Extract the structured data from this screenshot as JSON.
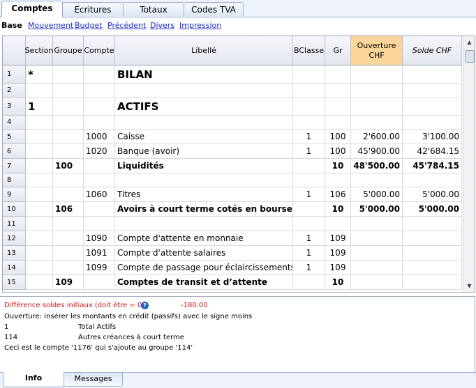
{
  "tabs": [
    {
      "label": "Comptes",
      "active": true
    },
    {
      "label": "Ecritures",
      "active": false
    },
    {
      "label": "Totaux",
      "active": false
    },
    {
      "label": "Codes TVA",
      "active": false
    }
  ],
  "subnav": {
    "current": "Base",
    "links": [
      "Mouvement",
      "Budget",
      "Précédent",
      "Divers",
      "Impression"
    ]
  },
  "columns": [
    {
      "label": "Section"
    },
    {
      "label": "Groupe"
    },
    {
      "label": "Compte"
    },
    {
      "label": "Libellé"
    },
    {
      "label": "BClasse"
    },
    {
      "label": "Gr"
    },
    {
      "label": "Ouverture CHF"
    },
    {
      "label": "Solde CHF"
    }
  ],
  "rows": [
    {
      "num": "1",
      "section": "*",
      "groupe": "",
      "compte": "",
      "libelle": "BILAN",
      "bclasse": "",
      "gr": "",
      "ouverture": "",
      "solde": "",
      "style": "title"
    },
    {
      "num": "2",
      "section": "",
      "groupe": "",
      "compte": "",
      "libelle": "",
      "bclasse": "",
      "gr": "",
      "ouverture": "",
      "solde": "",
      "style": ""
    },
    {
      "num": "3",
      "section": "1",
      "groupe": "",
      "compte": "",
      "libelle": "ACTIFS",
      "bclasse": "",
      "gr": "",
      "ouverture": "",
      "solde": "",
      "style": "title"
    },
    {
      "num": "4",
      "section": "",
      "groupe": "",
      "compte": "",
      "libelle": "",
      "bclasse": "",
      "gr": "",
      "ouverture": "",
      "solde": "",
      "style": ""
    },
    {
      "num": "5",
      "section": "",
      "groupe": "",
      "compte": "1000",
      "libelle": "Caisse",
      "bclasse": "1",
      "gr": "100",
      "ouverture": "2'600.00",
      "solde": "3'100.00",
      "style": ""
    },
    {
      "num": "6",
      "section": "",
      "groupe": "",
      "compte": "1020",
      "libelle": "Banque (avoir)",
      "bclasse": "1",
      "gr": "100",
      "ouverture": "45'900.00",
      "solde": "42'684.15",
      "style": ""
    },
    {
      "num": "7",
      "section": "",
      "groupe": "100",
      "compte": "",
      "libelle": "Liquidités",
      "bclasse": "",
      "gr": "10",
      "ouverture": "48'500.00",
      "solde": "45'784.15",
      "style": "bold"
    },
    {
      "num": "8",
      "section": "",
      "groupe": "",
      "compte": "",
      "libelle": "",
      "bclasse": "",
      "gr": "",
      "ouverture": "",
      "solde": "",
      "style": ""
    },
    {
      "num": "9",
      "section": "",
      "groupe": "",
      "compte": "1060",
      "libelle": "Titres",
      "bclasse": "1",
      "gr": "106",
      "ouverture": "5'000.00",
      "solde": "5'000.00",
      "style": ""
    },
    {
      "num": "10",
      "section": "",
      "groupe": "106",
      "compte": "",
      "libelle": "Avoirs à court terme cotés en bourse",
      "bclasse": "",
      "gr": "10",
      "ouverture": "5'000.00",
      "solde": "5'000.00",
      "style": "bold"
    },
    {
      "num": "11",
      "section": "",
      "groupe": "",
      "compte": "",
      "libelle": "",
      "bclasse": "",
      "gr": "",
      "ouverture": "",
      "solde": "",
      "style": ""
    },
    {
      "num": "12",
      "section": "",
      "groupe": "",
      "compte": "1090",
      "libelle": "Compte d'attente en monnaie",
      "bclasse": "1",
      "gr": "109",
      "ouverture": "",
      "solde": "",
      "style": ""
    },
    {
      "num": "13",
      "section": "",
      "groupe": "",
      "compte": "1091",
      "libelle": "Compte d'attente salaires",
      "bclasse": "1",
      "gr": "109",
      "ouverture": "",
      "solde": "",
      "style": ""
    },
    {
      "num": "14",
      "section": "",
      "groupe": "",
      "compte": "1099",
      "libelle": "Compte de passage pour éclaircissements",
      "bclasse": "1",
      "gr": "109",
      "ouverture": "",
      "solde": "",
      "style": ""
    },
    {
      "num": "15",
      "section": "",
      "groupe": "109",
      "compte": "",
      "libelle": "Comptes de transit et d’attente",
      "bclasse": "",
      "gr": "10",
      "ouverture": "",
      "solde": "",
      "style": "bold"
    }
  ],
  "info": {
    "diff_label": "Différence soldes initiaux (doit être = 0)",
    "diff_value": "-180.00",
    "help_glyph": "?",
    "hint": "Ouverture: insérer les montants en crédit (passifs) avec le signe moins",
    "item1_key": "1",
    "item1_val": "Total Actifs",
    "item2_key": "114",
    "item2_val": "Autres créances à court terme",
    "note": "Ceci est le compte '1176' qui s'ajoute au groupe '114'"
  },
  "bottom_tabs": [
    {
      "label": "Info",
      "active": true
    },
    {
      "label": "Messages",
      "active": false
    }
  ],
  "colors": {
    "accent_header": "#fcd59a",
    "link": "#1b2cc9",
    "error": "#d2141b"
  }
}
